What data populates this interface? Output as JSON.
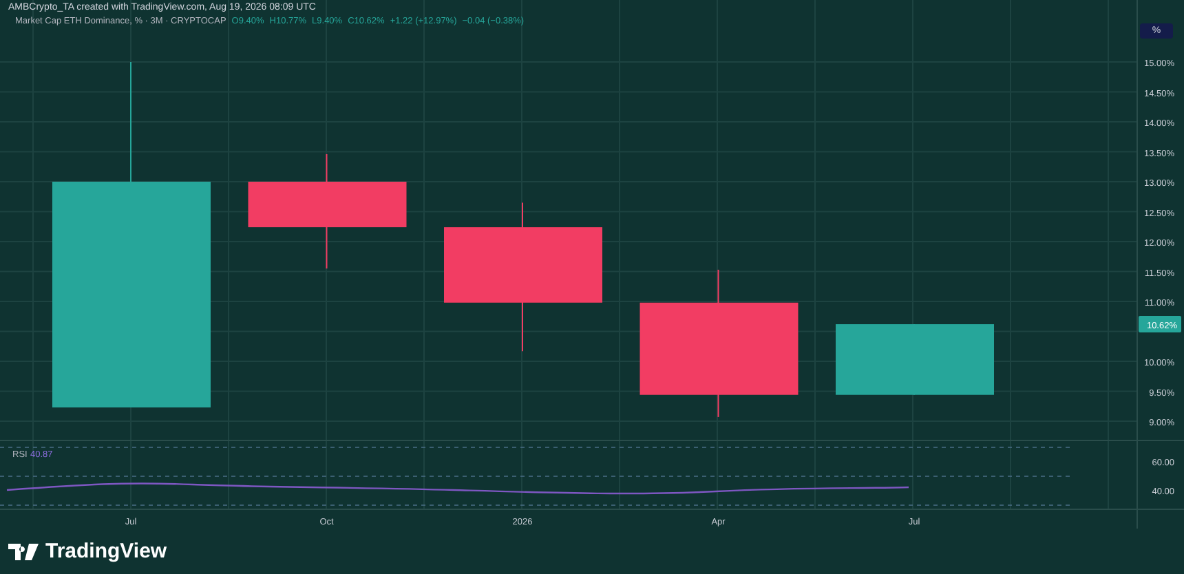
{
  "caption": "AMBCrypto_TA created with TradingView.com, Aug 19, 2026 08:09 UTC",
  "legend": {
    "title": "Market Cap ETH Dominance, % · 3M · CRYPTOCAP",
    "values": [
      "O9.40%",
      "H10.77%",
      "L9.40%",
      "C10.62%",
      "+1.22 (+12.97%)",
      "−0.04 (−0.38%)"
    ]
  },
  "scale_button": "%",
  "price_chart": {
    "candles": [
      {
        "kind": "up"
      },
      {
        "kind": "down"
      },
      {
        "kind": "down"
      },
      {
        "kind": "down"
      },
      {
        "kind": "up"
      }
    ],
    "last_price": "10.62%",
    "price_axis_upper": [
      "15.00%",
      "14.50%",
      "14.00%",
      "13.50%",
      "13.00%",
      "12.50%",
      "12.00%",
      "11.50%",
      "11.00%"
    ],
    "price_axis_lower": [
      "10.00%",
      "9.50%",
      "9.00%"
    ],
    "time_axis": [
      "Jul",
      "Oct",
      "2026",
      "Apr",
      "Jul"
    ]
  },
  "rsi": {
    "label": "RSI",
    "value": "40.87",
    "axis_labels": [
      "60.00",
      "40.00"
    ]
  },
  "logo": "TradingView"
}
